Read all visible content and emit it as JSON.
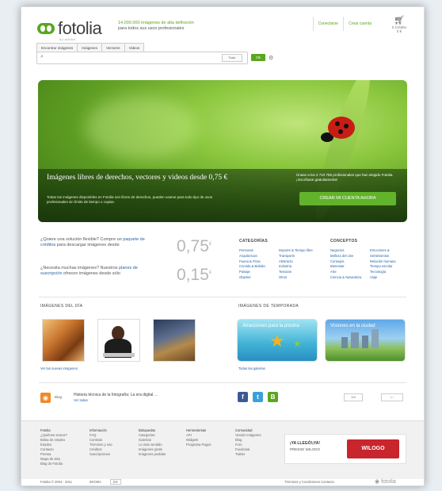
{
  "header": {
    "logo_text": "fotolia",
    "logo_sub": "by adobe",
    "tagline_line1": "14.000.000 imágenes de alta definición",
    "tagline_line2": "para todos sus usos profesionales",
    "link_register": "Conectarse",
    "link_account": "Crear cuenta",
    "cart_label": "0 Crédito",
    "cart_sub": "0 €"
  },
  "tabs": [
    "Encontrar imágenes",
    "Imágenes",
    "Vectores",
    "Videos"
  ],
  "search": {
    "placeholder": "",
    "select_value": "Todo",
    "button": "Ok"
  },
  "hero": {
    "title": "Imágenes libres de derechos, vectores y videos desde 0,75 €",
    "body": "Todas las imágenes disponibles en Fotolia son libres de derechos, pueden usarse para todo tipo de usos profesionales sin límite de tiempo o copias.",
    "cta_text": "Únase a los 2 710 755 profesionales que han elegido Fotolia. ¡Inscríbase gratuitamente!",
    "cta_button": "CREAR MI CUENTA AHORA"
  },
  "offers": [
    {
      "text": "¿Quiere una solución flexible? Compre un",
      "link": "paquete de créditos",
      "text2": "para descargar imágenes desde",
      "price": "0,75",
      "currency": "€"
    },
    {
      "text": "¿Necesita muchas imágenes? Nuestros",
      "link": "planes de suscripción",
      "text2": "ofrecen imágenes desde sólo",
      "price": "0,15",
      "currency": "€"
    }
  ],
  "categories": {
    "title": "CATEGORÍAS",
    "col1": [
      "Personas",
      "Arquitectura",
      "Fauna & Flora",
      "Comida & Bebida",
      "Paisaje",
      "Objetos"
    ],
    "col2": [
      "Deporte & Tiempo libre",
      "Transporte",
      "Abstracto",
      "Industria",
      "Texturas",
      "Otros"
    ]
  },
  "concepts": {
    "title": "CONCEPTOS",
    "col1": [
      "Negocios",
      "Belleza del cine",
      "Consejos",
      "Bienestar",
      "Arte",
      "Ciencia & Naturaleza"
    ],
    "col2": [
      "Emociones & Sentimientos",
      "Relación humana",
      "Tiempo escolar",
      "Tecnología",
      "Viaje"
    ]
  },
  "sections": {
    "day_title": "IMÁGENES DEL DÍA",
    "day_link": "Ver las nuevas imágenes",
    "season_title": "IMÁGENES DE TEMPORADA",
    "season_link": "Todas las galerías",
    "season_card1": "Atracciones para la piscina",
    "season_card2": "Visiones en la ciudad"
  },
  "news": {
    "label": "Blog",
    "text": "Historia técnica de la fotografía: La era digital ...",
    "more": "Ver todas",
    "page": "1/3",
    "nav": "< ›"
  },
  "footer": {
    "col1": [
      "Fotolia",
      "¿Quiénes somos?",
      "Bolsa de empleo",
      "Empleo",
      "Contacto",
      "Prensa",
      "Mapa de sitio",
      "Blog de Fotolia"
    ],
    "col2": [
      "Información",
      "FAQ",
      "Contrato",
      "Términos y uso",
      "Créditos",
      "Suscripciones"
    ],
    "col3": [
      "Búsquedas",
      "Categorías",
      "Galerías",
      "Lo más vendido",
      "Imágenes gratis",
      "Imágenes pedidas"
    ],
    "col4": [
      "Herramientas",
      "API",
      "Widgets",
      "Programa Pagos"
    ],
    "col5": [
      "Comunidad",
      "Vender imágenes",
      "Blog",
      "Foro",
      "Facebook",
      "Twitter"
    ],
    "ad_text1": "¡YA LLEGÓ!¡YA!",
    "ad_text2": "PRESSE WILOGO",
    "ad_brand": "WILOGO"
  },
  "bottom": {
    "copyright": "Fotolia © 2004 - 2011",
    "lang_label": "IDIOMA",
    "lang_value": "ES",
    "links": "Términos y Condiciones   Contacto",
    "brand": "fotolia"
  },
  "colors": {
    "brand_green": "#5aa61f",
    "link_blue": "#2a63a6"
  }
}
